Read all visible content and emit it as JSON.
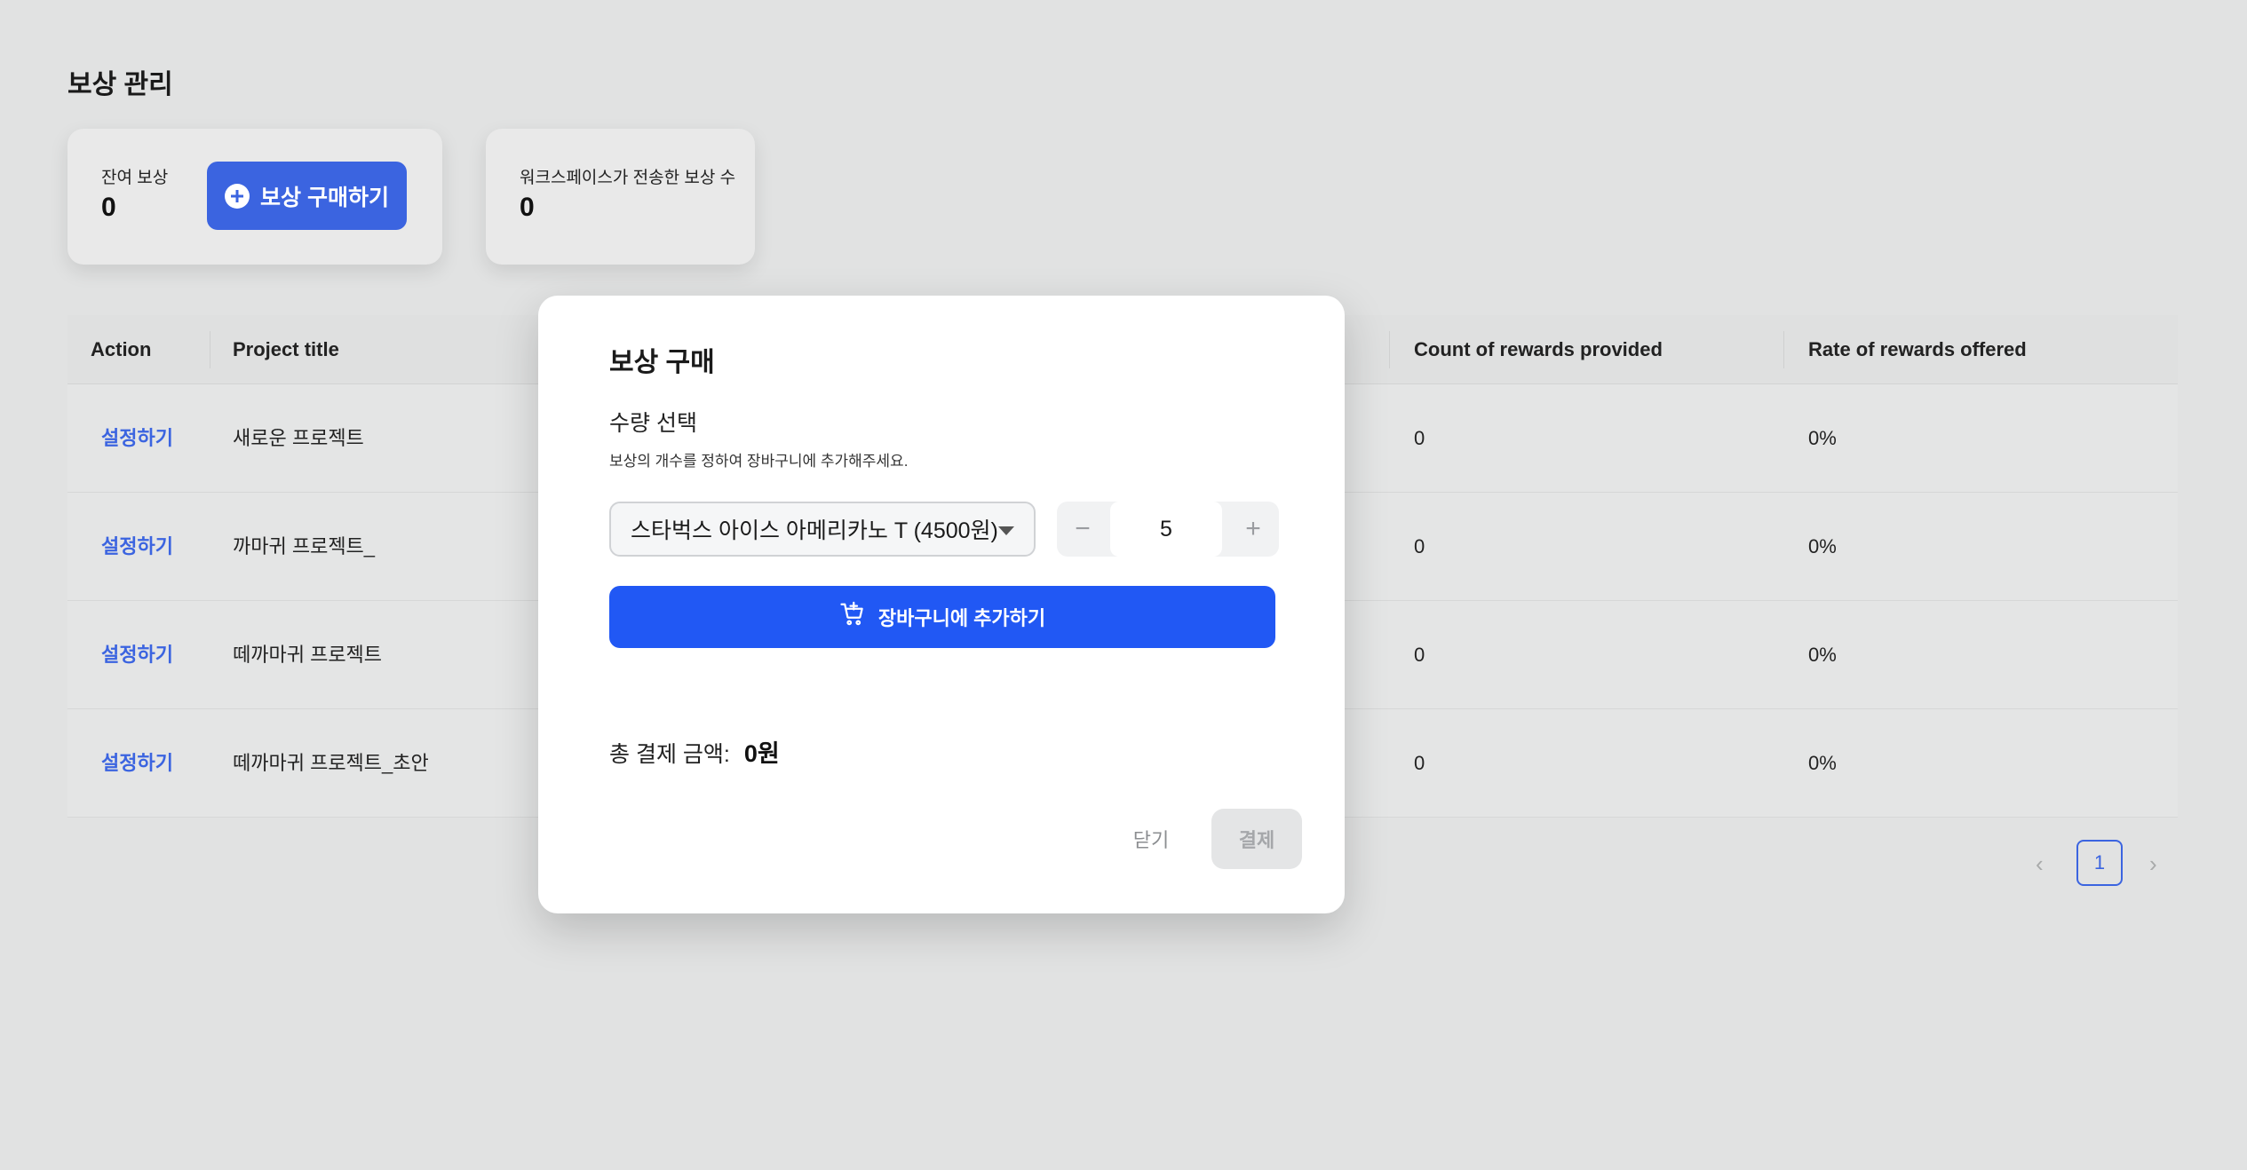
{
  "page": {
    "title": "보상 관리"
  },
  "cards": {
    "remaining": {
      "label": "잔여 보상",
      "value": "0",
      "buy_button": "보상 구매하기"
    },
    "sent": {
      "label": "워크스페이스가 전송한 보상 수",
      "value": "0"
    }
  },
  "table": {
    "columns": [
      "Action",
      "Project title",
      "Count of rewards provided",
      "Rate of rewards offered"
    ],
    "rows": [
      {
        "action": "설정하기",
        "title": "새로운 프로젝트",
        "count": "0",
        "rate": "0%"
      },
      {
        "action": "설정하기",
        "title": "까마귀 프로젝트_",
        "count": "0",
        "rate": "0%"
      },
      {
        "action": "설정하기",
        "title": "떼까마귀 프로젝트",
        "count": "0",
        "rate": "0%"
      },
      {
        "action": "설정하기",
        "title": "떼까마귀 프로젝트_초안",
        "count": "0",
        "rate": "0%"
      }
    ]
  },
  "pagination": {
    "prev": "‹",
    "current": "1",
    "next": "›"
  },
  "modal": {
    "title": "보상 구매",
    "quantity_label": "수량 선택",
    "quantity_help": "보상의 개수를 정하여 장바구니에 추가해주세요.",
    "product_select": "스타벅스 아이스 아메리카노 T (4500원)",
    "quantity_value": "5",
    "minus": "−",
    "plus": "+",
    "add_to_cart": "장바구니에 추가하기",
    "total_label": "총 결제 금액:",
    "total_value": "0원",
    "close": "닫기",
    "pay": "결제"
  },
  "colors": {
    "accent": "#2158f4",
    "link": "#3b64e0",
    "backdrop": "#e1e2e2"
  }
}
